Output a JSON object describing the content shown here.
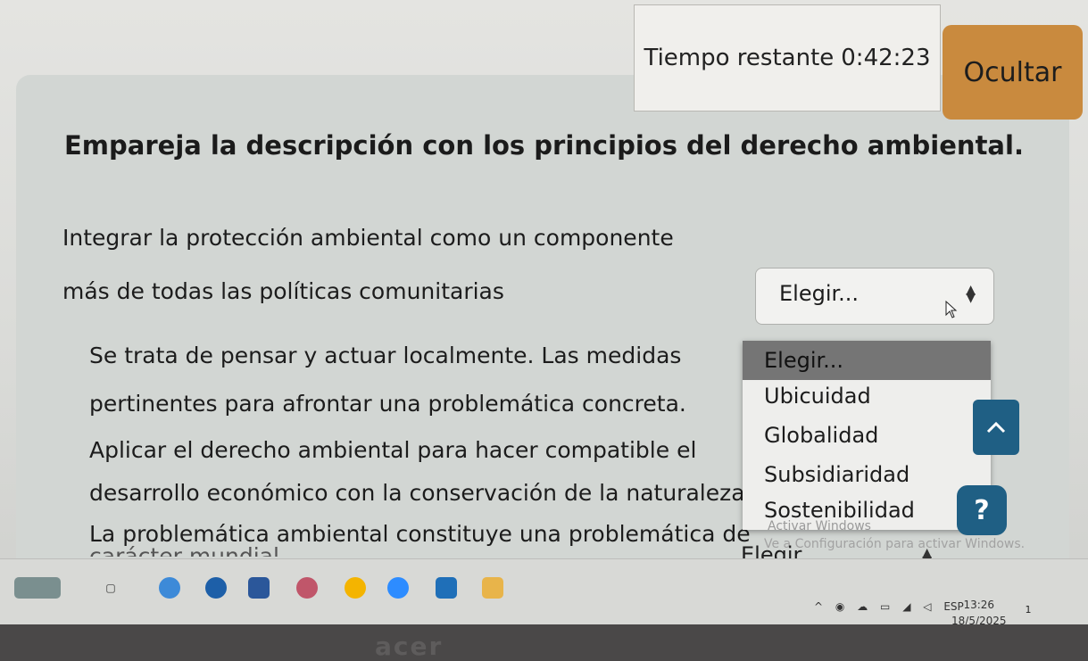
{
  "timer": {
    "label": "Tiempo restante",
    "value": "0:42:23"
  },
  "hide_button": "Ocultar",
  "question": "Empareja la descripción con los principios del derecho ambiental.",
  "items": [
    {
      "line1": "Integrar la protección ambiental como un componente",
      "line2": "más de todas las políticas comunitarias"
    },
    {
      "line1": "Se trata de pensar y actuar localmente. Las medidas",
      "line2": "pertinentes para afrontar una problemática concreta."
    },
    {
      "line1": "Aplicar el derecho ambiental para hacer compatible el",
      "line2": "desarrollo económico con la conservación de la naturaleza."
    },
    {
      "line1": "La problemática ambiental constituye una problemática de",
      "line2": "carácter mundial"
    }
  ],
  "select_placeholder": "Elegir...",
  "dropdown": {
    "options": [
      "Elegir...",
      "Ubicuidad",
      "Globalidad",
      "Subsidiaridad",
      "Sostenibilidad"
    ],
    "selected_index": 0
  },
  "watermark": {
    "line1": "Activar Windows",
    "line2": "Ve a Configuración para activar Windows."
  },
  "help_label": "?",
  "taskbar": {
    "tray_language": "ESP",
    "time": "13:26",
    "date": "18/5/2025",
    "notification_count": "1"
  },
  "bezel_brand": "acer",
  "colors": {
    "hide_button": "#c98a3e",
    "fab": "#1f5f84",
    "selected_option": "#757575"
  },
  "icons": [
    "chevron-up-icon",
    "help-icon",
    "updown-arrows-icon",
    "mouse-cursor-icon"
  ]
}
